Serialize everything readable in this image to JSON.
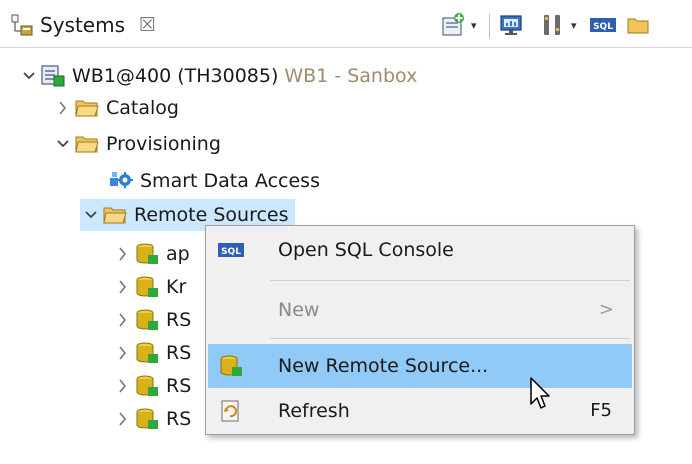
{
  "view": {
    "tab_label": "Systems",
    "tab_close": "☒",
    "toolbar": {
      "dropdown_caret": "▾",
      "sql_badge": "SQL"
    }
  },
  "tree": {
    "system": {
      "label": "WB1@400 (TH30085)",
      "tag": "WB1 - Sanbox"
    },
    "catalog": "Catalog",
    "provisioning": "Provisioning",
    "smart_data_access": "Smart Data Access",
    "remote_sources": "Remote Sources",
    "children": [
      {
        "label": "ap"
      },
      {
        "label": "Kr"
      },
      {
        "label": "RS"
      },
      {
        "label": "RS"
      },
      {
        "label": "RS"
      },
      {
        "label": "RS"
      }
    ]
  },
  "context_menu": {
    "sql_badge": "SQL",
    "items": [
      {
        "label": "Open SQL Console"
      },
      {
        "label": "New",
        "submenu_arrow": ">"
      },
      {
        "label": "New Remote Source..."
      },
      {
        "label": "Refresh",
        "shortcut": "F5"
      }
    ]
  },
  "colors": {
    "selection": "#cce8ff",
    "menu_hover": "#91c9f7",
    "connection_tag": "#a08c6a",
    "folder": "#e8b94a",
    "database": "#d9b21a"
  }
}
